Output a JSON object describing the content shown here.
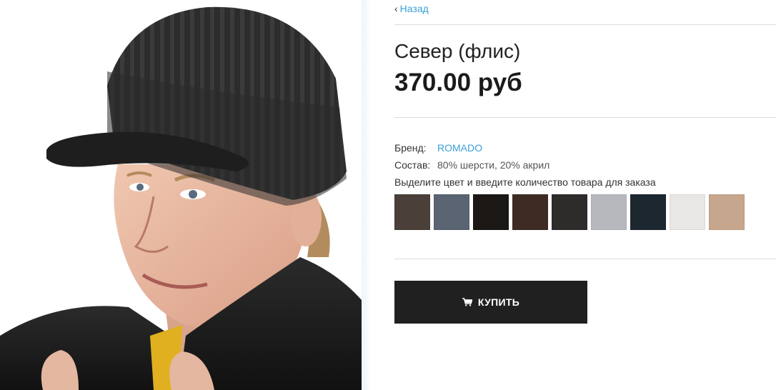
{
  "nav": {
    "back_label": "Назад",
    "back_icon": "chevron-left-icon"
  },
  "product": {
    "title": "Север (флис)",
    "price": "370.00 руб",
    "image_alt": "photo of a man wearing a dark knitted visor beanie"
  },
  "properties": {
    "brand_label": "Бренд:",
    "brand_value": "ROMADO",
    "composition_label": "Состав:",
    "composition_value": "80% шерсти, 20% акрил"
  },
  "colors": {
    "hint": "Выделите цвет и введите количество товара для заказа",
    "swatches": [
      "#4a3f39",
      "#5a6473",
      "#1b1715",
      "#3e2c24",
      "#2e2c2a",
      "#b7b8be",
      "#1c2730",
      "#e9e7e6",
      "#c6a68c"
    ]
  },
  "cart": {
    "buy_label": "КУПИТЬ",
    "icon": "cart-icon"
  },
  "theme": {
    "link_color": "#3aa0d8",
    "button_bg": "#202020"
  }
}
